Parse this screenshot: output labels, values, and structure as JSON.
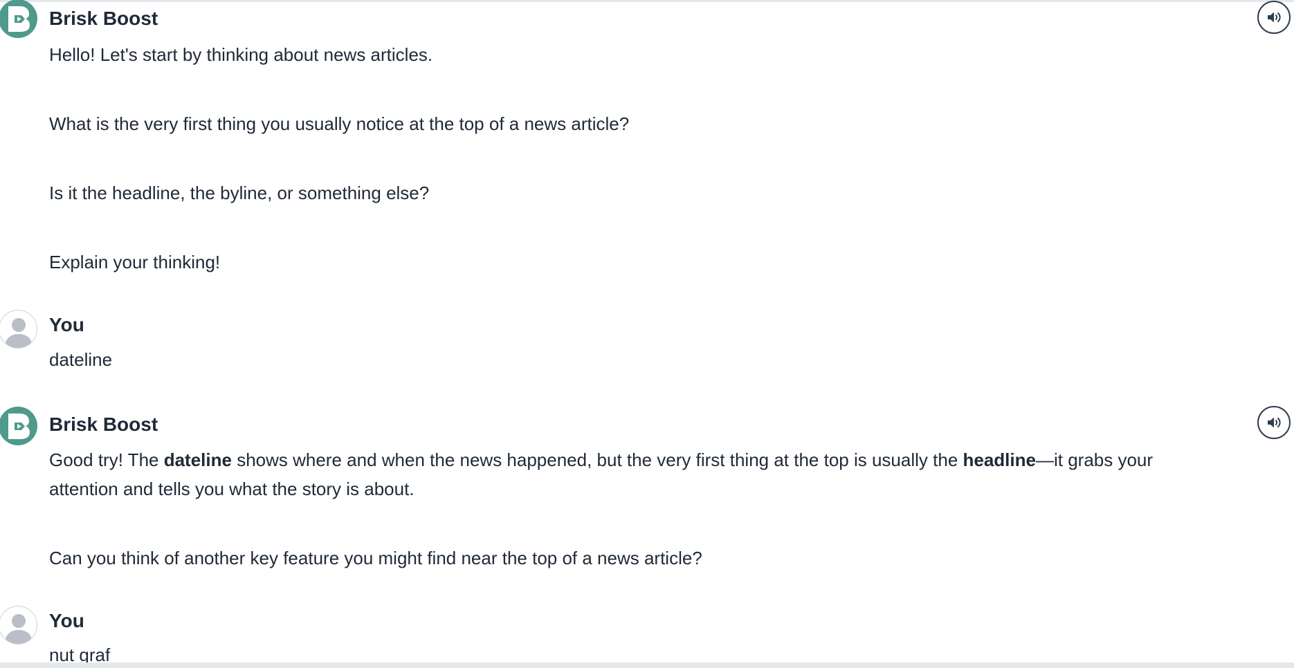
{
  "brand_color": "#4f9a8d",
  "text_color": "#1f2937",
  "messages": [
    {
      "author": "Brisk Boost",
      "paragraphs": [
        "Hello! Let's start by thinking about news articles.",
        "What is the very first thing you usually notice at the top of a news article?",
        "Is it the headline, the byline, or something else?",
        "Explain your thinking!"
      ],
      "audio_icon": "speaker-icon"
    },
    {
      "author": "You",
      "paragraphs": [
        "dateline"
      ]
    },
    {
      "author": "Brisk Boost",
      "reply": {
        "p1_a": "Good try! The ",
        "p1_b": "dateline",
        "p1_c": " shows where and when the news happened, but the very first thing at the top is usually the ",
        "p1_d": "headline",
        "p1_e": "—it grabs your",
        "p1_line2": "attention and tells you what the story is about.",
        "p2": "Can you think of another key feature you might find near the top of a news article?"
      },
      "audio_icon": "speaker-icon"
    },
    {
      "author": "You",
      "paragraphs": [
        "nut graf"
      ]
    }
  ]
}
